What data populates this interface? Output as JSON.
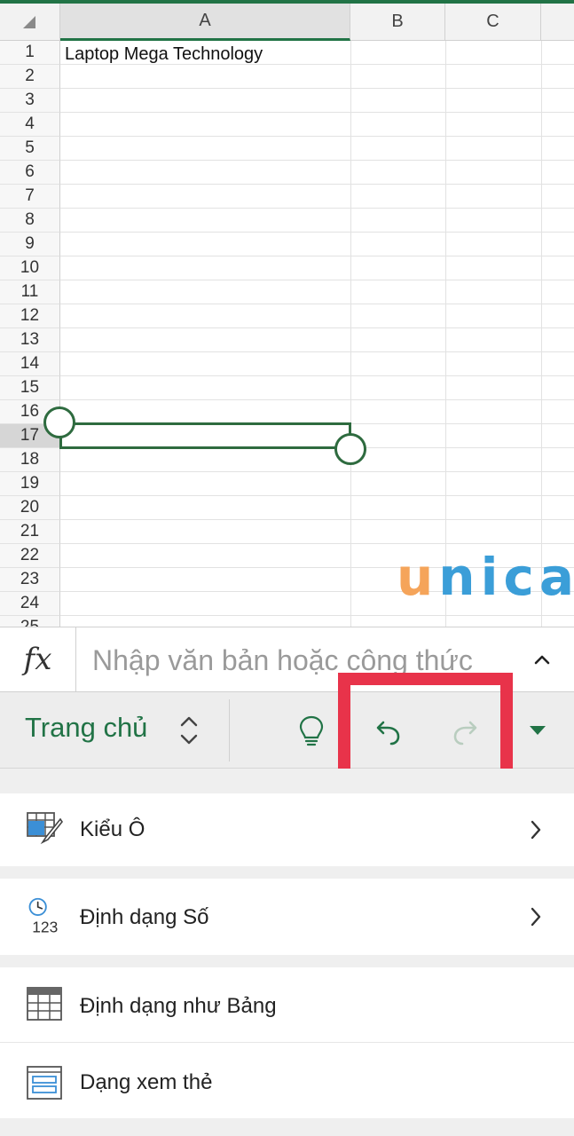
{
  "spreadsheet": {
    "columns": [
      "A",
      "B",
      "C"
    ],
    "selected_column": "A",
    "rows": [
      "1",
      "2",
      "3",
      "4",
      "5",
      "6",
      "7",
      "8",
      "9",
      "10",
      "11",
      "12",
      "13",
      "14",
      "15",
      "16",
      "17",
      "18",
      "19",
      "20",
      "21",
      "22",
      "23",
      "24",
      "25"
    ],
    "selected_row": "17",
    "cells": {
      "A1": "Laptop Mega Technology"
    }
  },
  "watermark": {
    "letters": [
      "u",
      "n",
      "i",
      "c",
      "a"
    ],
    "colors": [
      "#f5a45a",
      "#3b9ed8",
      "#3b9ed8",
      "#3b9ed8",
      "#3b9ed8"
    ]
  },
  "formula_bar": {
    "fx_label": "fx",
    "placeholder": "Nhập văn bản hoặc công thức"
  },
  "toolbar": {
    "tab_label": "Trang chủ",
    "icons": [
      "lightbulb-icon",
      "undo-icon",
      "redo-icon",
      "dropdown-icon"
    ]
  },
  "menu": {
    "items": [
      {
        "label": "Kiểu Ô",
        "icon": "cell-style-icon",
        "has_chevron": true
      },
      {
        "label": "Định dạng Số",
        "icon": "number-format-icon",
        "icon_text": "123",
        "has_chevron": true
      },
      {
        "label": "Định dạng như Bảng",
        "icon": "table-format-icon",
        "has_chevron": false
      },
      {
        "label": "Dạng xem thẻ",
        "icon": "card-view-icon",
        "has_chevron": false
      }
    ]
  },
  "colors": {
    "accent": "#217346",
    "selection": "#2e6b3f",
    "highlight": "#e8334a"
  }
}
